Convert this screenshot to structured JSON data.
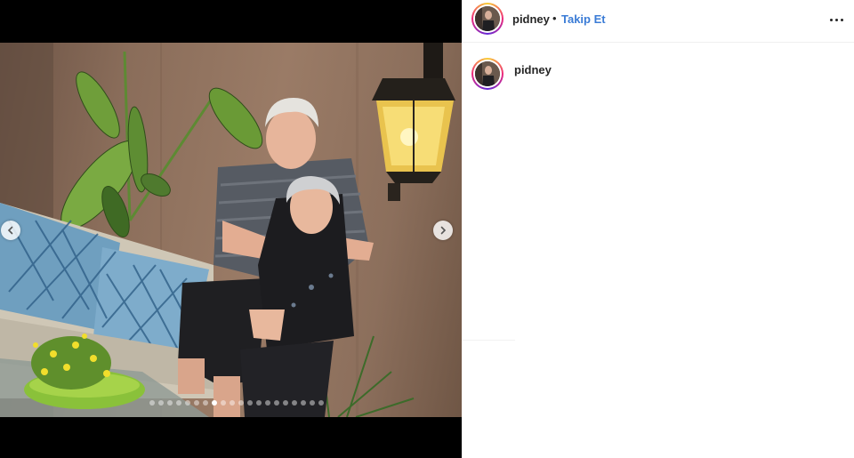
{
  "post": {
    "username": "pidney",
    "separator": "•",
    "follow_label": "Takip Et",
    "more_icon": "more-horizontal-icon"
  },
  "caption": {
    "username": "pidney"
  },
  "carousel": {
    "prev_icon": "chevron-left-icon",
    "next_icon": "chevron-right-icon",
    "total_slides": 20,
    "active_index": 7
  },
  "colors": {
    "follow_blue": "#3b7cd6",
    "story_ring_start": "#f9ce34",
    "story_ring_mid": "#ee2a7b",
    "story_ring_end": "#6228d7"
  }
}
